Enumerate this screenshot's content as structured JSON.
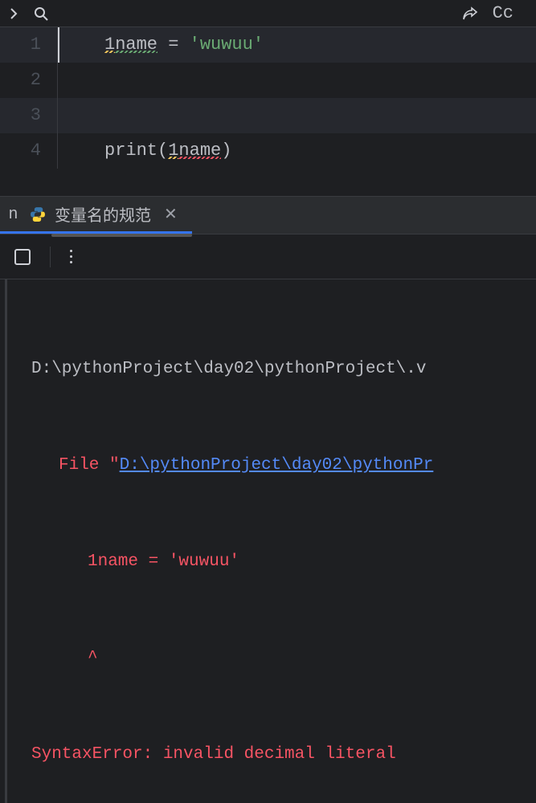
{
  "toolbar": {
    "back_icon": "chevron-right",
    "search_icon": "search",
    "share_icon": "share",
    "cc_label": "Cc"
  },
  "editor": {
    "lines": [
      {
        "n": "1"
      },
      {
        "n": "2"
      },
      {
        "n": "3"
      },
      {
        "n": "4"
      }
    ],
    "line1": {
      "prefix": "1",
      "name": "name",
      "eq": " = ",
      "q1": "'",
      "str": "wuwuu",
      "q2": "'"
    },
    "line4": {
      "fn": "print",
      "lpar": "(",
      "prefix": "1",
      "name": "name",
      "rpar": ")"
    }
  },
  "tabs": {
    "left_stub": "n",
    "active": {
      "label": "变量名的规范"
    }
  },
  "console": {
    "cmd": "D:\\pythonProject\\day02\\pythonProject\\.v",
    "file_prefix": "File \"",
    "file_link": "D:\\pythonProject\\day02\\pythonPr",
    "code_echo": "1name = 'wuwuu'",
    "caret": "^",
    "error": "SyntaxError: invalid decimal literal"
  }
}
